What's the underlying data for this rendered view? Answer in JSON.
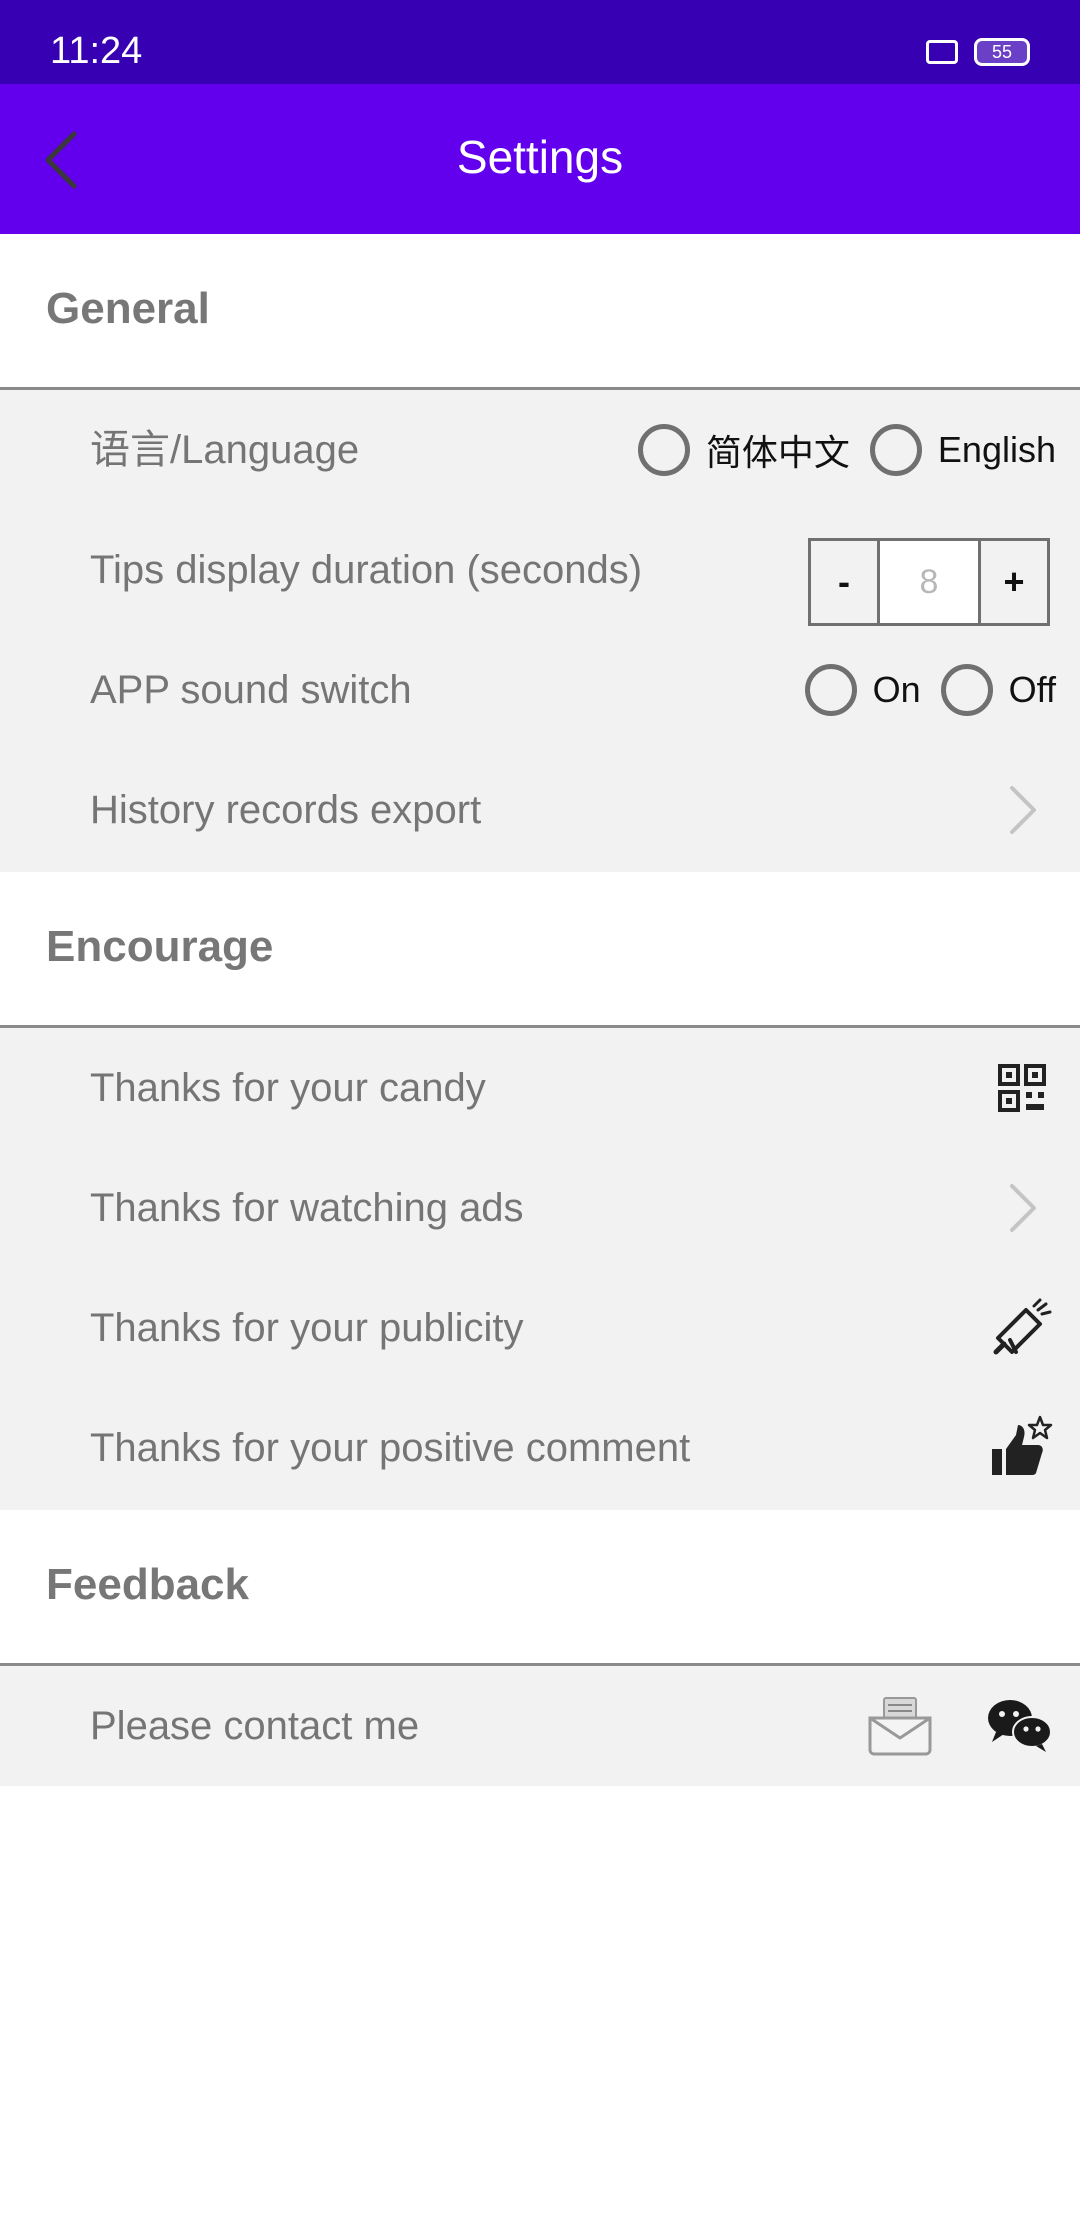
{
  "status_bar": {
    "time": "11:24",
    "battery": "55"
  },
  "app_bar": {
    "title": "Settings"
  },
  "sections": {
    "general": {
      "title": "General",
      "language": {
        "label": "语言/Language",
        "option_cn": "简体中文",
        "option_en": "English"
      },
      "tips": {
        "label": "Tips display duration (seconds)",
        "minus": "-",
        "value": "8",
        "plus": "+"
      },
      "sound": {
        "label": "APP sound switch",
        "option_on": "On",
        "option_off": "Off"
      },
      "history": {
        "label": "History records export"
      }
    },
    "encourage": {
      "title": "Encourage",
      "candy": {
        "label": "Thanks for your candy"
      },
      "ads": {
        "label": "Thanks for watching ads"
      },
      "publicity": {
        "label": "Thanks for your publicity"
      },
      "comment": {
        "label": "Thanks for your positive comment"
      }
    },
    "feedback": {
      "title": "Feedback",
      "contact": {
        "label": "Please contact me"
      }
    }
  },
  "icons": {
    "back": "chevron-left-icon",
    "history": "chevron-right-icon",
    "candy": "qr-code-icon",
    "ads": "chevron-right-icon",
    "publicity": "megaphone-icon",
    "comment": "thumbs-up-star-icon",
    "email": "mail-icon",
    "wechat": "wechat-icon"
  },
  "colors": {
    "status_bar": "#3700b3",
    "app_bar": "#6200ee",
    "group_bg": "#f2f2f2",
    "label_text": "#757575"
  }
}
